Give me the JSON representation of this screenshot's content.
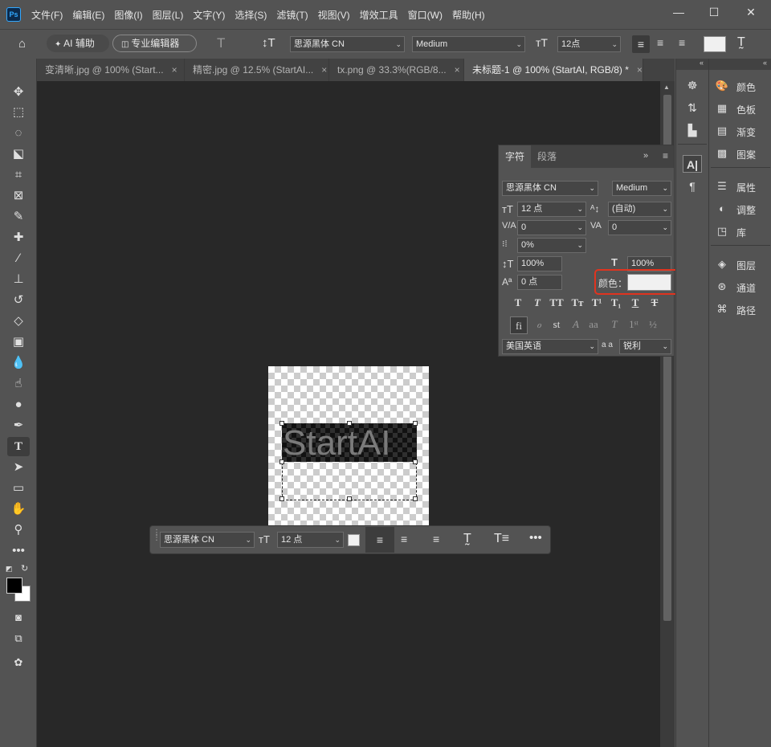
{
  "menubar": {
    "logo": "Ps",
    "items": [
      "文件(F)",
      "编辑(E)",
      "图像(I)",
      "图层(L)",
      "文字(Y)",
      "选择(S)",
      "滤镜(T)",
      "视图(V)",
      "增效工具",
      "窗口(W)",
      "帮助(H)"
    ]
  },
  "options": {
    "ai_assist": "AI 辅助",
    "pro_editor": "专业编辑器",
    "font_family": "思源黑体 CN",
    "font_style": "Medium",
    "font_size": "12点"
  },
  "tabs": [
    {
      "label": "变清晰.jpg @ 100% (Start...",
      "close": "×"
    },
    {
      "label": "精密.jpg @ 12.5% (StartAI...",
      "close": "×"
    },
    {
      "label": "tx.png @ 33.3%(RGB/8...",
      "close": "×"
    },
    {
      "label": "未标题-1 @ 100% (StartAI, RGB/8) *",
      "close": "×"
    }
  ],
  "canvas": {
    "layer_text": "StartAI"
  },
  "context_bar": {
    "font_family": "思源黑体 CN",
    "font_size": "12 点"
  },
  "char_panel": {
    "tab_char": "字符",
    "tab_para": "段落",
    "font_family": "思源黑体 CN",
    "font_style": "Medium",
    "font_size": "12 点",
    "leading": "(自动)",
    "kerning": "0",
    "tracking": "0",
    "tsume": "0%",
    "vscale": "100%",
    "hscale": "100%",
    "baseline": "0 点",
    "color_label": "颜色：",
    "language": "美国英语",
    "aa_label": "a a",
    "antialias": "锐利"
  },
  "dock": {
    "items": [
      "颜色",
      "色板",
      "渐变",
      "图案",
      "属性",
      "调整",
      "库",
      "图层",
      "通道",
      "路径"
    ]
  },
  "colors": {
    "text_color_swatch": "#f0f0f0",
    "highlight": "#e0341f"
  }
}
